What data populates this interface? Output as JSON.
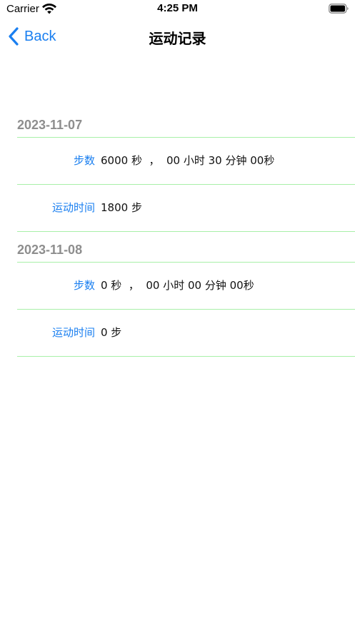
{
  "status_bar": {
    "carrier": "Carrier",
    "time": "4:25 PM"
  },
  "nav": {
    "back_label": "Back",
    "title": "运动记录"
  },
  "sections": [
    {
      "date": "2023-11-07",
      "rows": [
        {
          "label": "步数",
          "value": "6000 秒  ，  00 小时 30 分钟 00秒"
        },
        {
          "label": "运动时间",
          "value": "1800 步"
        }
      ]
    },
    {
      "date": "2023-11-08",
      "rows": [
        {
          "label": "步数",
          "value": "0 秒  ，  00 小时 00 分钟 00秒"
        },
        {
          "label": "运动时间",
          "value": "0 步"
        }
      ]
    }
  ],
  "colors": {
    "accent": "#1a7ff0",
    "separator": "#a8f0a8",
    "section_header_text": "#8e8e8e"
  },
  "icons": {
    "wifi": "wifi-icon",
    "battery": "battery-icon",
    "back": "chevron-left-icon"
  }
}
